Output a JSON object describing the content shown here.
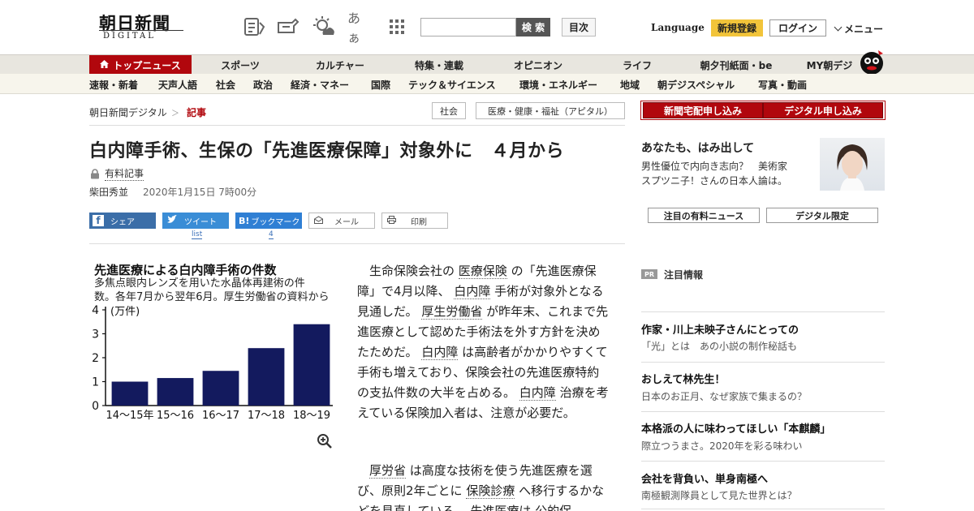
{
  "header": {
    "logo_main": "朝日新聞",
    "logo_sub": "DIGITAL",
    "icon_kana": "あぁ",
    "search_button": "検 索",
    "toc_button": "目次",
    "language": "Language",
    "register": "新規登録",
    "login": "ログイン",
    "menu": "メニュー"
  },
  "nav_primary": [
    "トップニュース",
    "スポーツ",
    "カルチャー",
    "特集・連載",
    "オピニオン",
    "ライフ",
    "朝夕刊紙面・be",
    "MY朝デジ"
  ],
  "nav_secondary": [
    "速報・新着",
    "天声人語",
    "社会",
    "政治",
    "経済・マネー",
    "国際",
    "テック＆サイエンス",
    "環境・エネルギー",
    "地域",
    "朝デジスペシャル",
    "写真・動画"
  ],
  "breadcrumb": {
    "home": "朝日新聞デジタル",
    "sep": "＞",
    "current": "記事",
    "tags": [
      "社会",
      "医療・健康・福祉（アピタル）"
    ]
  },
  "article": {
    "headline": "白内障手術、生保の「先進医療保障」対象外に　４月から",
    "paid_label": "有料記事",
    "author": "柴田秀並",
    "date": "2020年1月15日 7時00分",
    "share": {
      "facebook": "シェア",
      "twitter": "ツイート",
      "twitter_sub": "list",
      "hatena_icon": "B!",
      "hatena": "ブックマーク",
      "hatena_count": "4",
      "mail": "メール",
      "print": "印刷"
    },
    "p1": [
      {
        "t": "生命保険会社の "
      },
      {
        "t": "医療保険",
        "kw": true
      },
      {
        "t": " の「先進医療保障」で4月以降、 "
      },
      {
        "t": "白内障",
        "kw": true
      },
      {
        "t": " 手術が対象外となる見通しだ。 "
      },
      {
        "t": "厚生労働省",
        "kw": true
      },
      {
        "t": " が昨年末、これまで先進医療として認めた手術法を外す方針を決めたためだ。 "
      },
      {
        "t": "白内障",
        "kw": true
      },
      {
        "t": " は高齢者がかかりやすくて手術も増えており、保険会社の先進医療特約の支払件数の大半を占める。 "
      },
      {
        "t": "白内障",
        "kw": true
      },
      {
        "t": " 治療を考えている保険加入者は、注意が必要だ。"
      }
    ],
    "p2": [
      {
        "t": "厚労省",
        "kw": true
      },
      {
        "t": " は高度な技術を使う先進医療を選び、原則2年ごとに "
      },
      {
        "t": "保険診療",
        "kw": true
      },
      {
        "t": " へ移行するかなどを見直している。 "
      },
      {
        "t": "先進医療",
        "kw": true
      },
      {
        "t": "は 公的保"
      }
    ]
  },
  "chart": {
    "title": "先進医療による白内障手術の件数",
    "subtitle_lines": [
      "多焦点眼内レンズを用いた水晶体再建術の件",
      "数。各年7月から翌年6月。厚生労働省の資料から"
    ]
  },
  "chart_data": {
    "type": "bar",
    "title": "先進医療による白内障手術の件数",
    "subtitle": "多焦点眼内レンズを用いた水晶体再建術の件数。各年7月から翌年6月。厚生労働省の資料から",
    "ylabel": "(万件)",
    "categories": [
      "14～15年",
      "15～16",
      "16～17",
      "17～18",
      "18～19"
    ],
    "values": [
      1.0,
      1.15,
      1.45,
      2.4,
      3.4
    ],
    "yticks": [
      0,
      1,
      2,
      3,
      4
    ],
    "ylim": [
      0,
      4
    ],
    "bar_color": "#131a5e",
    "grid": false,
    "legend": "none"
  },
  "sidebar": {
    "subscribe_home": "新聞宅配申し込み",
    "subscribe_digital": "デジタル申し込み",
    "promo_title": "あなたも、はみ出して",
    "promo_lines": [
      "男性優位で内向き志向？　美術家",
      "スプツニ子！さんの日本人論は。"
    ],
    "tabs": [
      "注目の有料ニュース",
      "デジタル限定"
    ],
    "pr_badge": "PR",
    "pr_label": "注目情報",
    "items": [
      {
        "title": "作家・川上未映子さんにとっての",
        "sub": "「光」とは　あの小説の制作秘話も"
      },
      {
        "title": "おしえて林先生！",
        "sub": "日本のお正月、なぜ家族で集まるの？"
      },
      {
        "title": "本格派の人に味わってほしい「本麒麟」",
        "sub": "際立つうまさ。2020年を彩る味わい"
      },
      {
        "title": "会社を背負い、単身南極へ",
        "sub": "南極観測隊員として見た世界とは？"
      }
    ]
  },
  "colors": {
    "brand_red": "#b1070d",
    "register_yellow": "#f2c43a",
    "chart_bar": "#131a5e"
  }
}
